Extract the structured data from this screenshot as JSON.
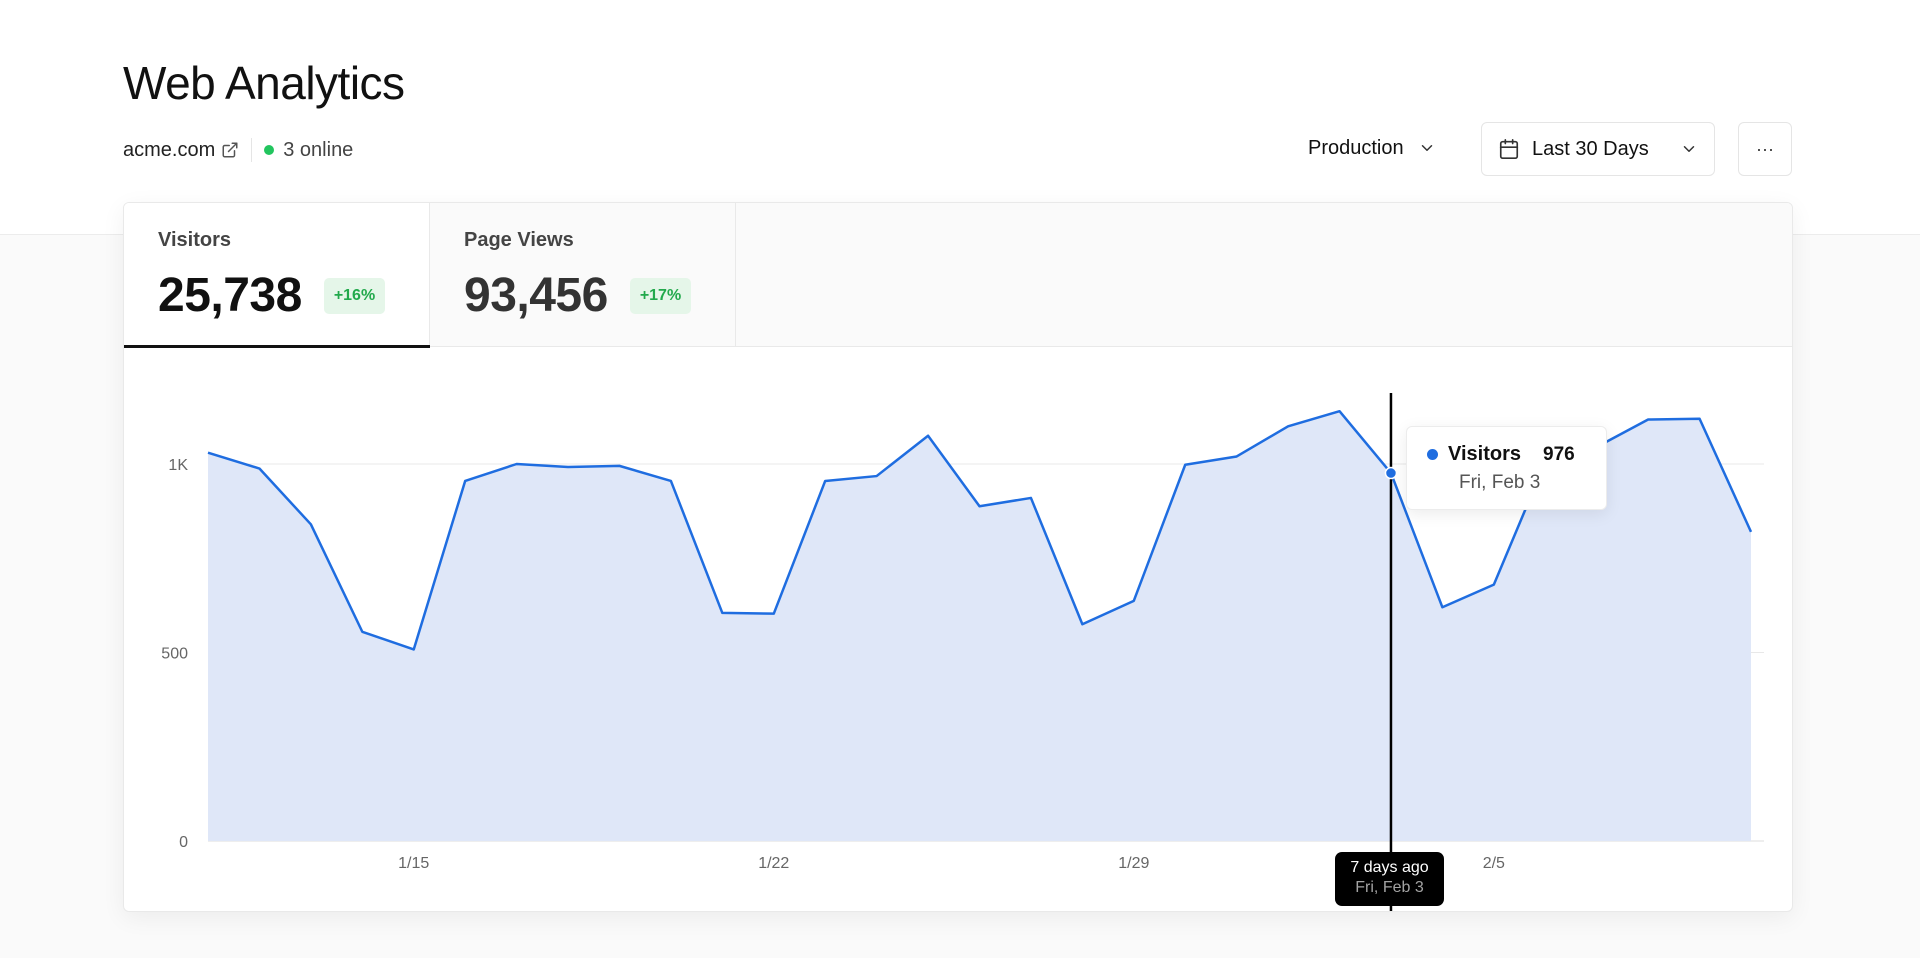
{
  "header": {
    "title": "Web Analytics",
    "site": "acme.com",
    "online": "3 online",
    "environment": "Production",
    "range": "Last 30 Days",
    "more": "···"
  },
  "tabs": [
    {
      "label": "Visitors",
      "value": "25,738",
      "change": "+16%"
    },
    {
      "label": "Page Views",
      "value": "93,456",
      "change": "+17%"
    }
  ],
  "tooltip": {
    "series": "Visitors",
    "value": "976",
    "date": "Fri, Feb 3"
  },
  "hover_label": {
    "relative": "7 days ago",
    "date": "Fri, Feb 3"
  },
  "colors": {
    "line": "#1f6de0",
    "area": "#dfe7f8",
    "online": "#22c55e",
    "badge_text": "#22a94c",
    "badge_bg": "#e5f6e9"
  },
  "chart_data": {
    "type": "area",
    "series": [
      {
        "name": "Visitors",
        "values": [
          1030,
          988,
          840,
          555,
          508,
          955,
          1000,
          992,
          995,
          955,
          605,
          603,
          955,
          968,
          1075,
          888,
          910,
          575,
          637,
          998,
          1020,
          1100,
          1140,
          976,
          620,
          680,
          1005,
          1045,
          1118,
          1120,
          820
        ]
      }
    ],
    "x_tick_labels": [
      "1/15",
      "1/22",
      "1/29",
      "2/5"
    ],
    "x_tick_indices": [
      4,
      11,
      18,
      25
    ],
    "y_tick_labels": [
      "0",
      "500",
      "1K"
    ],
    "y_ticks": [
      0,
      500,
      1000
    ],
    "ylim": [
      0,
      1000
    ],
    "highlight_index": 23,
    "grid": "horizontal"
  }
}
